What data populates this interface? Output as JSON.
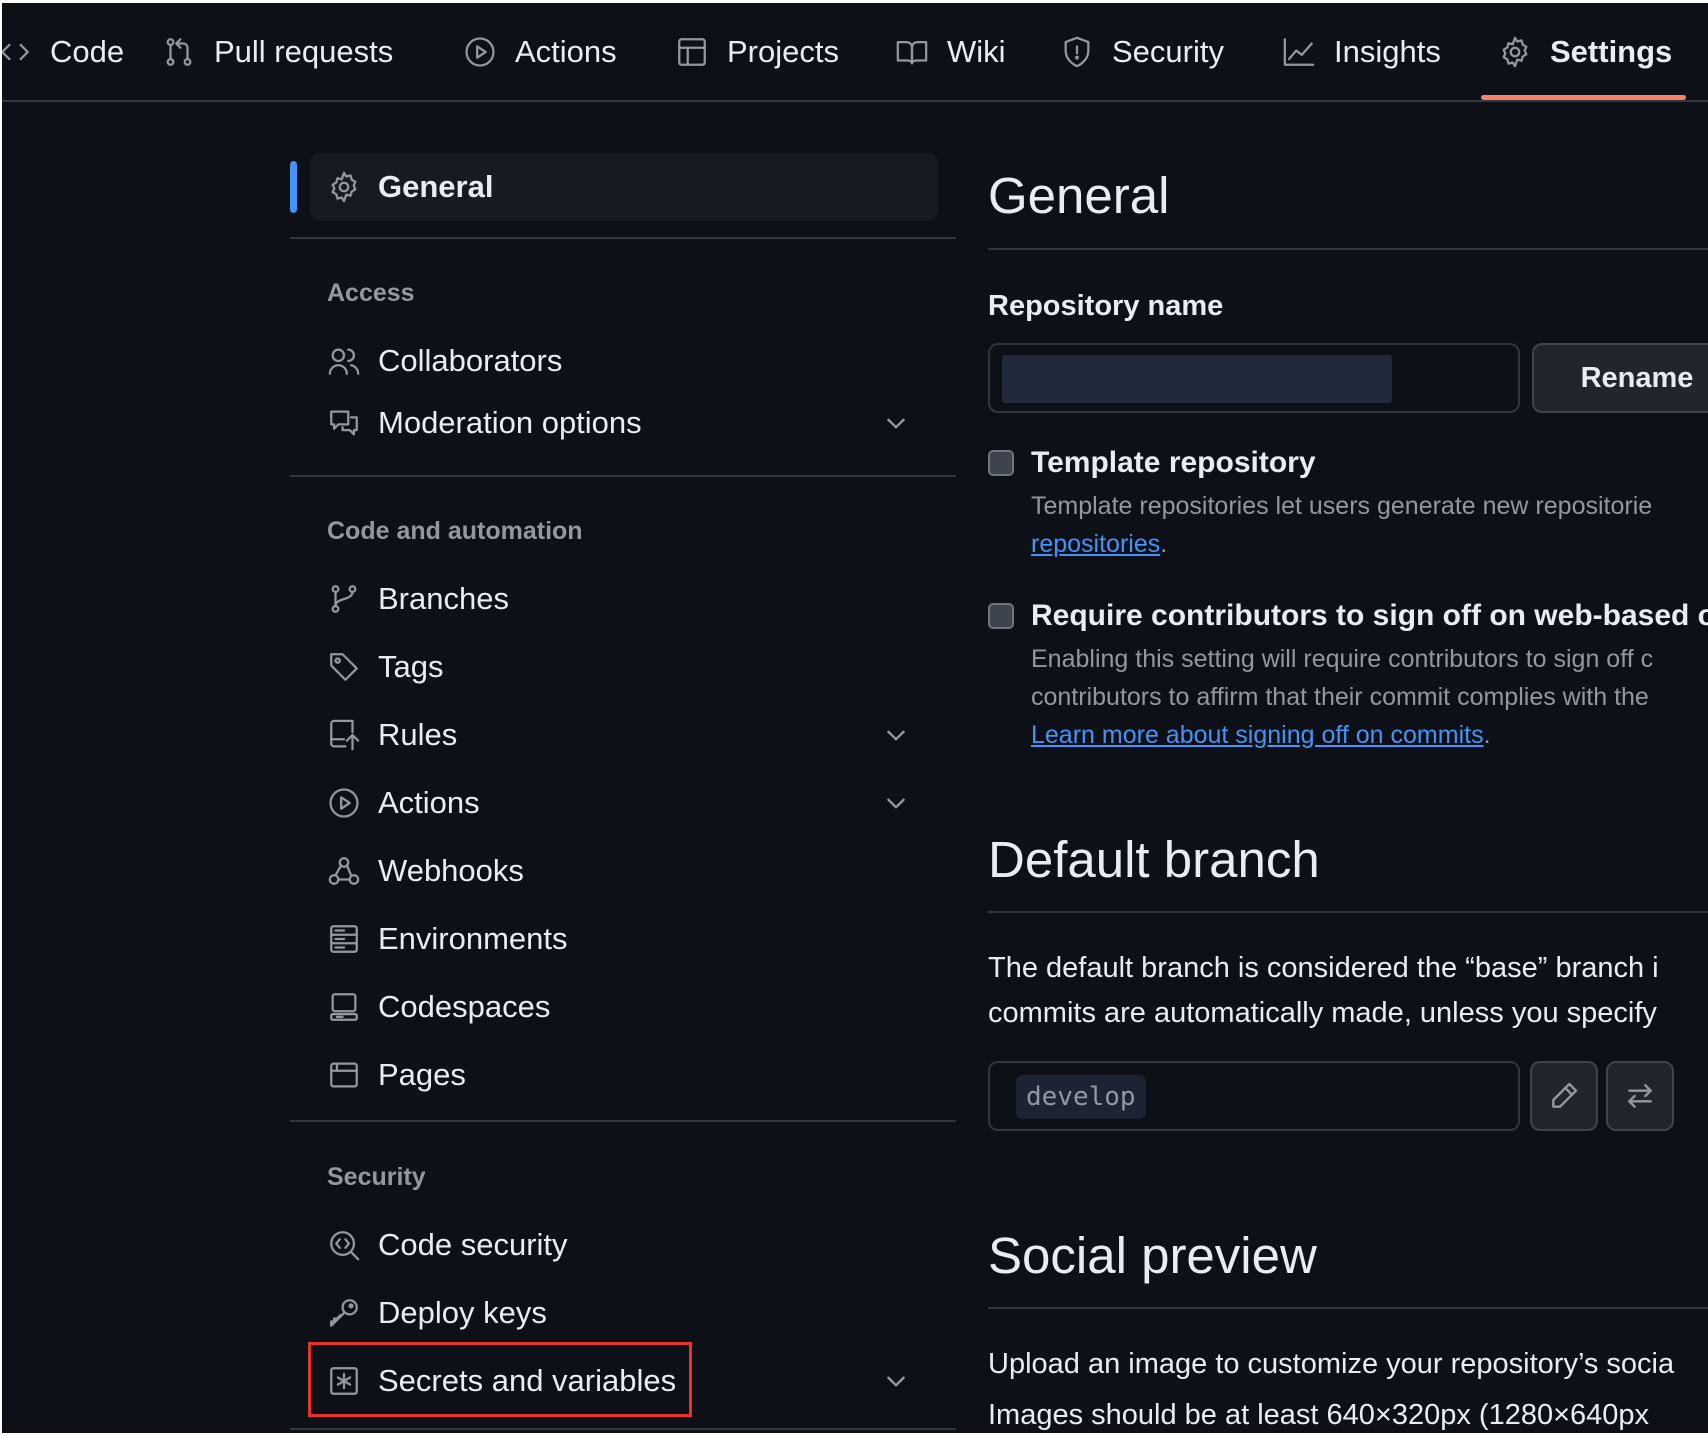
{
  "nav": {
    "tabs": [
      {
        "label": "Code",
        "icon": "code-icon"
      },
      {
        "label": "Pull requests",
        "icon": "pull-request-icon"
      },
      {
        "label": "Actions",
        "icon": "play-icon"
      },
      {
        "label": "Projects",
        "icon": "table-icon"
      },
      {
        "label": "Wiki",
        "icon": "book-icon"
      },
      {
        "label": "Security",
        "icon": "shield-icon"
      },
      {
        "label": "Insights",
        "icon": "graph-icon"
      },
      {
        "label": "Settings",
        "icon": "gear-icon"
      }
    ],
    "active": "Settings"
  },
  "sidebar": {
    "general": "General",
    "access_heading": "Access",
    "access_items": [
      {
        "label": "Collaborators",
        "icon": "people-icon",
        "expandable": false
      },
      {
        "label": "Moderation options",
        "icon": "comment-discussion-icon",
        "expandable": true
      }
    ],
    "code_heading": "Code and automation",
    "code_items": [
      {
        "label": "Branches",
        "icon": "git-branch-icon",
        "expandable": false
      },
      {
        "label": "Tags",
        "icon": "tag-icon",
        "expandable": false
      },
      {
        "label": "Rules",
        "icon": "repo-push-icon",
        "expandable": true
      },
      {
        "label": "Actions",
        "icon": "play-icon",
        "expandable": true
      },
      {
        "label": "Webhooks",
        "icon": "webhook-icon",
        "expandable": false
      },
      {
        "label": "Environments",
        "icon": "server-icon",
        "expandable": false
      },
      {
        "label": "Codespaces",
        "icon": "codespaces-icon",
        "expandable": false
      },
      {
        "label": "Pages",
        "icon": "browser-icon",
        "expandable": false
      }
    ],
    "security_heading": "Security",
    "security_items": [
      {
        "label": "Code security",
        "icon": "codescan-icon",
        "expandable": false
      },
      {
        "label": "Deploy keys",
        "icon": "key-icon",
        "expandable": false
      },
      {
        "label": "Secrets and variables",
        "icon": "asterisk-icon",
        "expandable": true
      }
    ]
  },
  "main": {
    "title": "General",
    "repo_name_label": "Repository name",
    "repo_name_value": "",
    "rename_button": "Rename",
    "template": {
      "title": "Template repository",
      "desc": "Template repositories let users generate new repositorie",
      "link": "repositories",
      "after_link": "."
    },
    "signoff": {
      "title": "Require contributors to sign off on web-based c",
      "desc1": "Enabling this setting will require contributors to sign off c",
      "desc2": "contributors to affirm that their commit complies with the",
      "link": "Learn more about signing off on commits",
      "after_link": "."
    },
    "default_branch": {
      "title": "Default branch",
      "line1": "The default branch is considered the “base” branch i",
      "line2": "commits are automatically made, unless you specify",
      "branch": "develop"
    },
    "social_preview": {
      "title": "Social preview",
      "line1": "Upload an image to customize your repository’s socia",
      "line2": "Images should be at least 640×320px (1280×640px"
    }
  },
  "colors": {
    "background": "#0d1117",
    "accent_underline": "#f78166",
    "link": "#4493f8",
    "selected_bar": "#4493f8",
    "highlight": "#e5342b"
  }
}
